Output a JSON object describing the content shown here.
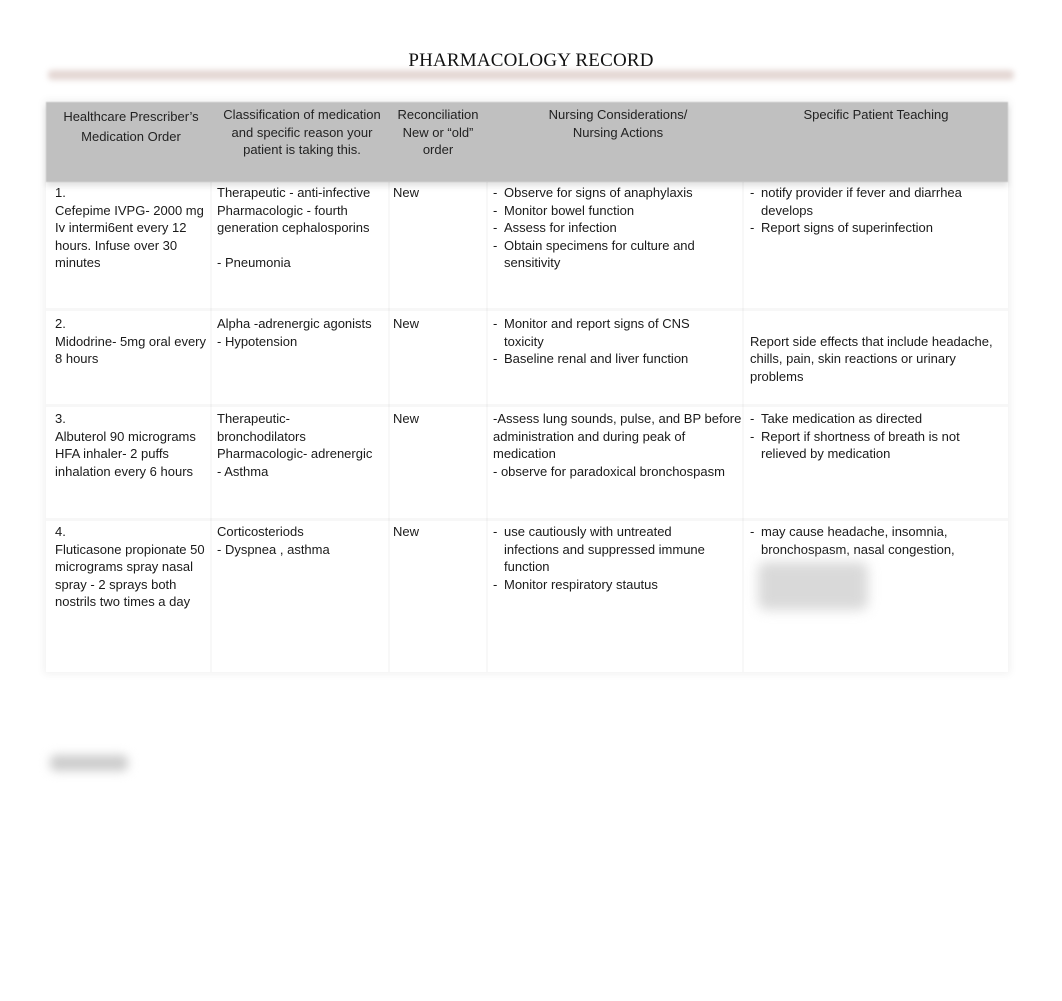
{
  "document": {
    "title": "PHARMACOLOGY RECORD"
  },
  "table": {
    "headers": [
      "Healthcare Prescriber’s Medication Order",
      "Classification of medication and specific reason your patient is taking this.",
      "Reconciliation New or “old” order",
      "Nursing Considerations/ Nursing Actions",
      "Specific Patient Teaching"
    ],
    "header_lines": {
      "order": [
        "Healthcare Prescriber’s",
        "Medication Order"
      ],
      "classification": [
        "Classification of medication",
        "and specific reason your",
        "patient is taking this."
      ],
      "reconciliation": [
        "Reconciliation",
        "New or “old”",
        "order"
      ],
      "nursing": [
        "Nursing Considerations/",
        "Nursing Actions"
      ],
      "teaching": [
        "Specific Patient Teaching"
      ]
    },
    "rows": [
      {
        "number": "1.",
        "order": "Cefepime IVPG- 2000 mg Iv intermi6ent every 12 hours. Infuse over 30 minutes",
        "classification": [
          "Therapeutic - anti-infective",
          "Pharmacologic - fourth generation cephalosporins",
          "",
          "- Pneumonia"
        ],
        "reconciliation": "New",
        "nursing": [
          "Observe for signs of anaphylaxis",
          "Monitor bowel function",
          "Assess for infection",
          "Obtain specimens for culture and sensitivity"
        ],
        "teaching": [
          "notify provider if fever and diarrhea develops",
          "Report signs of superinfection"
        ]
      },
      {
        "number": "2.",
        "order": "Midodrine- 5mg oral every 8 hours",
        "classification": [
          "Alpha -adrenergic agonists",
          "- Hypotension"
        ],
        "reconciliation": "New",
        "nursing": [
          "Monitor and report signs of CNS toxicity",
          "Baseline renal and liver function"
        ],
        "teaching_text": "Report side effects that include headache, chills, pain, skin reactions or urinary problems"
      },
      {
        "number": "3.",
        "order": "Albuterol 90 micrograms HFA inhaler- 2 puffs inhalation every 6 hours",
        "classification": [
          "Therapeutic-",
          "bronchodilators",
          "Pharmacologic- adrenergic",
          "- Asthma"
        ],
        "reconciliation": "New",
        "nursing_text": [
          "-Assess lung sounds, pulse, and BP before administration and during peak of medication",
          "- observe for paradoxical bronchospasm"
        ],
        "teaching": [
          "Take medication as directed",
          "Report if shortness of breath is not relieved by medication"
        ]
      },
      {
        "number": "4.",
        "order": "Fluticasone propionate 50 micrograms spray nasal spray - 2 sprays both nostrils two times a day",
        "classification": [
          "Corticosteriods",
          "- Dyspnea , asthma"
        ],
        "reconciliation": "New",
        "nursing": [
          "use cautiously with untreated infections and suppressed immune function",
          "Monitor respiratory stautus"
        ],
        "teaching": [
          "may cause headache, insomnia, bronchospasm, nasal congestion,"
        ]
      }
    ]
  }
}
